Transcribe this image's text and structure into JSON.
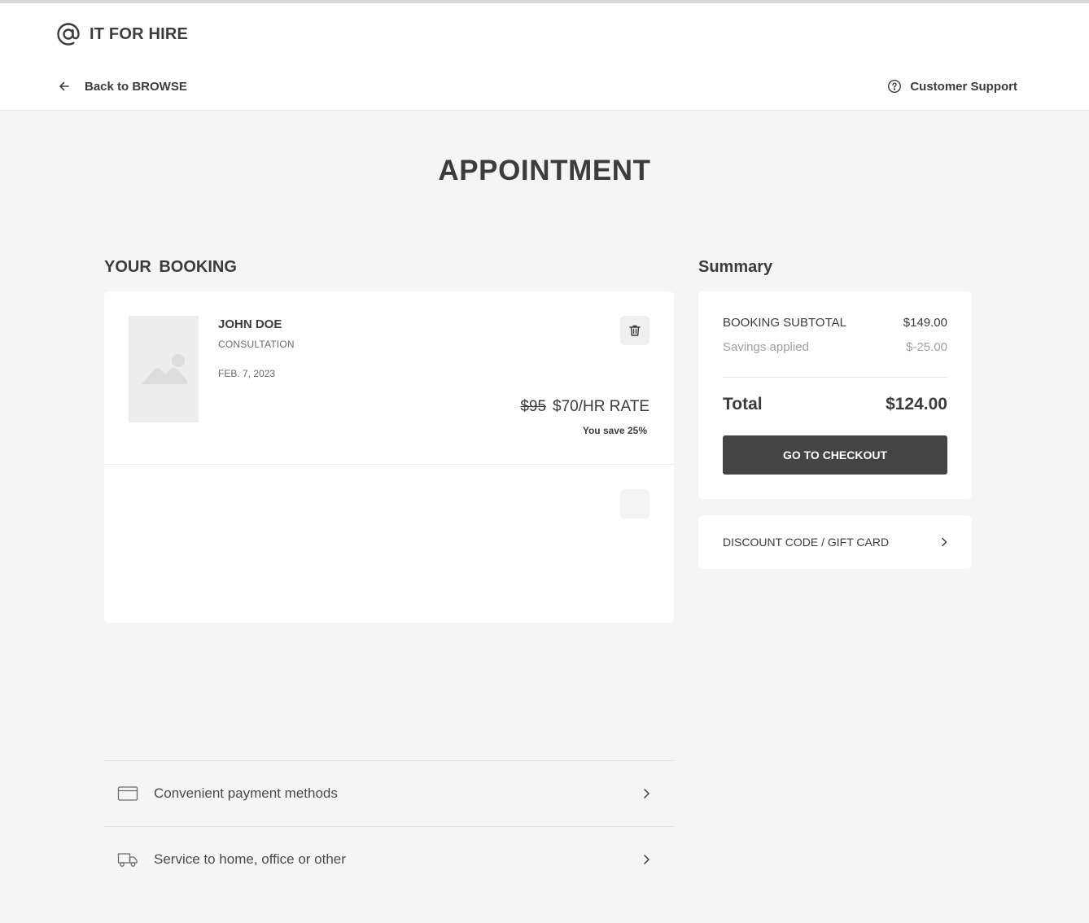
{
  "header": {
    "brand": "IT FOR HIRE",
    "back_label": "Back to BROWSE",
    "support_label": "Customer Support"
  },
  "page": {
    "title": "APPOINTMENT"
  },
  "booking": {
    "section_title": "YOUR  BOOKING",
    "item": {
      "name": "JOHN DOE",
      "type": "CONSULTATION",
      "date": "FEB. 7, 2023",
      "old_price": "$95",
      "new_price": "$70/HR RATE",
      "savings_note": "You save 25%"
    }
  },
  "summary": {
    "section_title": "Summary",
    "subtotal_label": "BOOKING SUBTOTAL",
    "subtotal_value": "$149.00",
    "savings_label": "Savings applied",
    "savings_value": "$-25.00",
    "total_label": "Total",
    "total_value": "$124.00",
    "checkout_label": "GO TO CHECKOUT"
  },
  "discount": {
    "label": "DISCOUNT CODE / GIFT CARD"
  },
  "features": [
    {
      "label": "Convenient payment methods",
      "icon": "credit-card-icon"
    },
    {
      "label": "Service to home, office or other",
      "icon": "truck-icon"
    }
  ],
  "icons": {
    "logo": "at-sign-icon",
    "back": "arrow-left-icon",
    "support": "help-circle-icon",
    "delete": "trash-icon",
    "image_placeholder": "image-placeholder-icon",
    "chevron": "chevron-right-icon"
  },
  "colors": {
    "text_primary": "#3c3c3c",
    "muted": "#a0a0a0",
    "button_dark": "#444444",
    "page_background": "#f5f5f5",
    "card_background": "#ffffff"
  }
}
